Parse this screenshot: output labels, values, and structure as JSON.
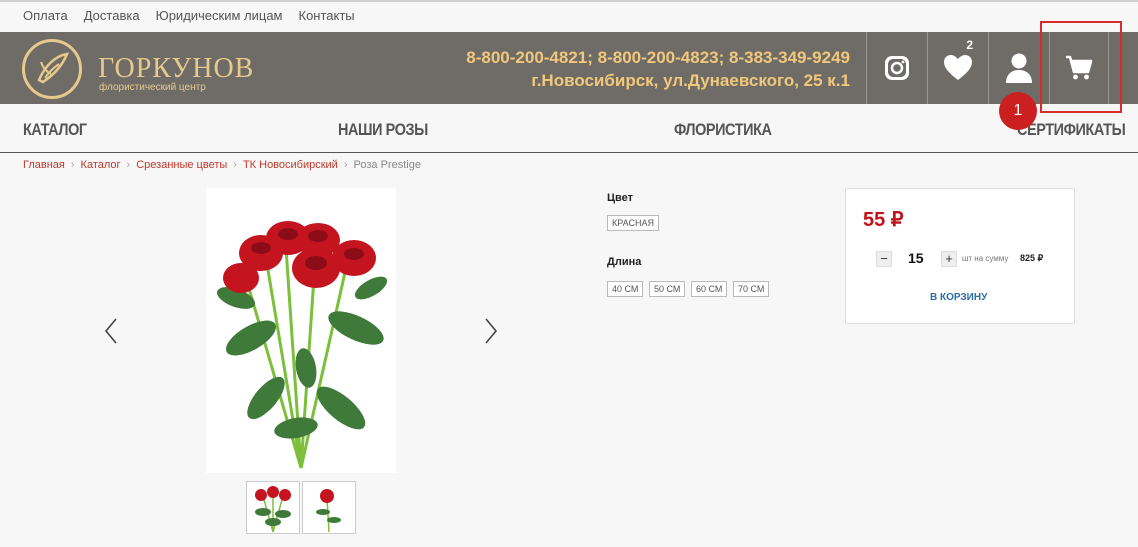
{
  "topnav": {
    "items": [
      "Оплата",
      "Доставка",
      "Юридическим лицам",
      "Контакты"
    ]
  },
  "header": {
    "logo_name": "ГОРКУНОВ",
    "logo_sub": "флористический центр",
    "phones": "8-800-200-4821; 8-800-200-4823; 8-383-349-9249",
    "address": "г.Новосибирск, ул.Дунаевского, 25 к.1",
    "favorites_count": "2",
    "icons": [
      "instagram-icon",
      "heart-icon",
      "user-icon",
      "cart-icon"
    ]
  },
  "mainnav": {
    "items": [
      "КАТАЛОГ",
      "НАШИ РОЗЫ",
      "ФЛОРИСТИКА",
      "СЕРТИФИКАТЫ"
    ]
  },
  "marker": {
    "label": "1"
  },
  "breadcrumb": {
    "items": [
      "Главная",
      "Каталог",
      "Срезанные цветы",
      "ТК Новосибирский"
    ],
    "current": "Роза Prestige"
  },
  "options": {
    "color_title": "Цвет",
    "color_value": "КРАСНАЯ",
    "length_title": "Длина",
    "lengths": [
      "40 СМ",
      "50 СМ",
      "60 СМ",
      "70 СМ"
    ]
  },
  "buy": {
    "price": "55 ₽",
    "qty": "15",
    "minus": "−",
    "plus": "+",
    "sum_label": "шт на сумму",
    "sum_value": "825 ₽",
    "cart_label": "В КОРЗИНУ"
  },
  "colors": {
    "header_bg": "#6f6c68",
    "gold": "#f1c87a",
    "accent_red": "#c0131b",
    "link_blue": "#2a6ea8"
  }
}
